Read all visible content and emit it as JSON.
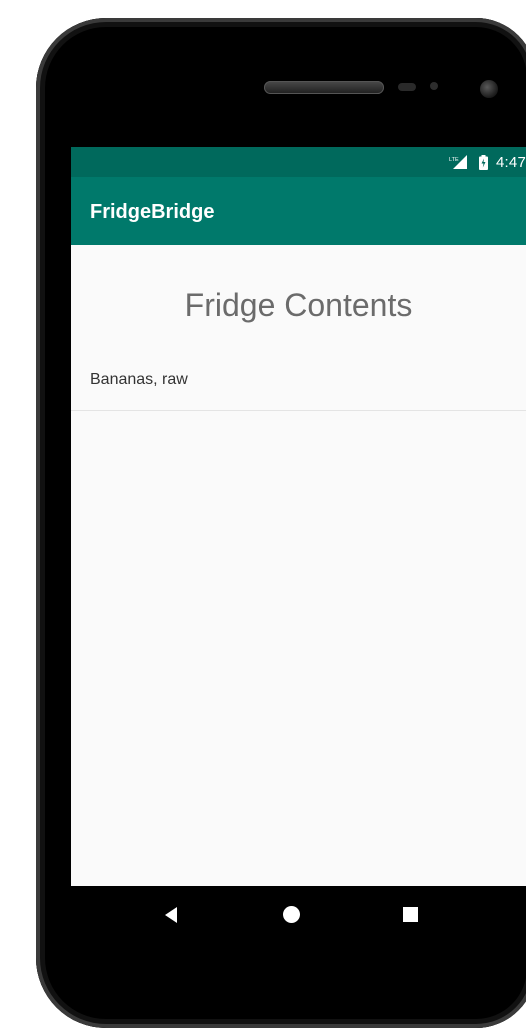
{
  "status_bar": {
    "time": "4:47",
    "network_icon": "lte-signal-icon",
    "battery_icon": "battery-charging-icon"
  },
  "app_bar": {
    "title": "FridgeBridge",
    "color": "#00796b"
  },
  "main": {
    "heading": "Fridge Contents",
    "items": [
      {
        "label": "Bananas, raw"
      }
    ]
  },
  "nav_bar": {
    "back_icon": "back-icon",
    "home_icon": "home-icon",
    "recents_icon": "recents-icon"
  },
  "colors": {
    "status_bar": "#00695c",
    "app_bar": "#00796b",
    "background": "#fafafa"
  }
}
